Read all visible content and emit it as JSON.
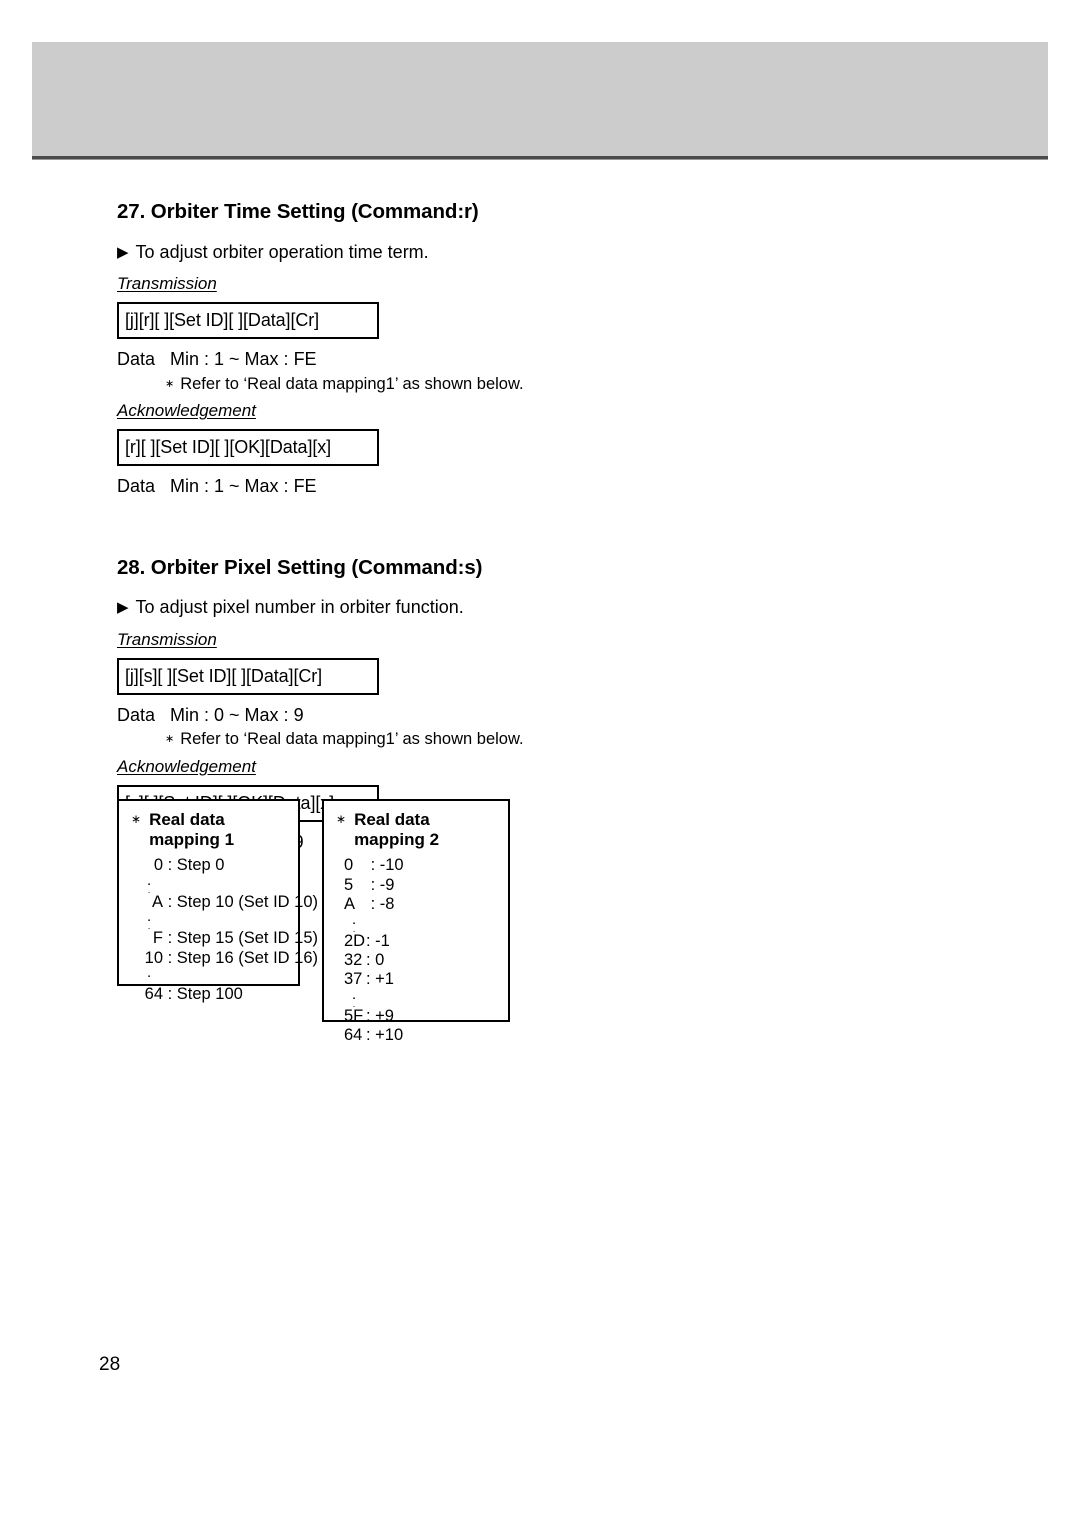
{
  "page": {
    "number": "28"
  },
  "sections": [
    {
      "title": "27. Orbiter Time Setting (Command:r)",
      "bullet_icon": "▶",
      "description": "To adjust orbiter operation time term.",
      "transmission_label": "Transmission",
      "transmission_command": "[j][r][  ][Set ID][  ][Data][Cr]",
      "transmission_data": "Data   Min : 1 ~ Max : FE",
      "refer_star": "∗",
      "refer_note": "Refer to ‘Real data mapping1’ as shown below.",
      "acknowledgement_label": "Acknowledgement",
      "acknowledgement_command": "[r][  ][Set ID][  ][OK][Data][x]",
      "acknowledgement_data": "Data   Min : 1 ~ Max : FE"
    },
    {
      "title": "28. Orbiter Pixel Setting (Command:s)",
      "bullet_icon": "▶",
      "description": "To adjust pixel number in orbiter function.",
      "transmission_label": "Transmission",
      "transmission_command": "[j][s][  ][Set ID][  ][Data][Cr]",
      "transmission_data": "Data   Min : 0 ~ Max : 9",
      "refer_star": "∗",
      "refer_note": "Refer to ‘Real data mapping1’ as shown below.",
      "acknowledgement_label": "Acknowledgement",
      "acknowledgement_command": "[s][  ][Set ID][  ][OK][Data][x]",
      "acknowledgement_data": "Data   Min : 0 ~ Max : 9"
    }
  ],
  "mapping_tables": [
    {
      "star": "∗",
      "title": "Real data mapping 1",
      "rows": [
        {
          "type": "entry",
          "key": "0",
          "sep": " : ",
          "value": "Step 0"
        },
        {
          "type": "dots"
        },
        {
          "type": "entry",
          "key": "A",
          "sep": " : ",
          "value": "Step 10 (Set ID 10)"
        },
        {
          "type": "dots"
        },
        {
          "type": "entry",
          "key": "F",
          "sep": " : ",
          "value": "Step 15 (Set ID 15)"
        },
        {
          "type": "entry",
          "key": "10",
          "sep": " : ",
          "value": "Step 16 (Set ID 16)"
        },
        {
          "type": "dots"
        },
        {
          "type": "entry",
          "key": "64",
          "sep": " : ",
          "value": "Step 100"
        }
      ]
    },
    {
      "star": "∗",
      "title": "Real data mapping 2",
      "rows": [
        {
          "type": "entry",
          "key": "0",
          "sep": " : ",
          "value": "-10"
        },
        {
          "type": "entry",
          "key": "5",
          "sep": " : ",
          "value": "-9"
        },
        {
          "type": "entry",
          "key": "A",
          "sep": " : ",
          "value": "-8"
        },
        {
          "type": "dots"
        },
        {
          "type": "entry",
          "key": "2D",
          "sep": ": ",
          "value": "-1"
        },
        {
          "type": "entry",
          "key": "32",
          "sep": ": ",
          "value": "0"
        },
        {
          "type": "entry",
          "key": "37",
          "sep": ": ",
          "value": "+1"
        },
        {
          "type": "dots"
        },
        {
          "type": "entry",
          "key": "5F",
          "sep": ": ",
          "value": "+9"
        },
        {
          "type": "entry",
          "key": "64",
          "sep": ": ",
          "value": "+10"
        }
      ]
    }
  ],
  "colors": {
    "header_band": "#cccccc",
    "header_rule": "#4a4a4a",
    "text": "#000000",
    "page_background": "#ffffff"
  }
}
